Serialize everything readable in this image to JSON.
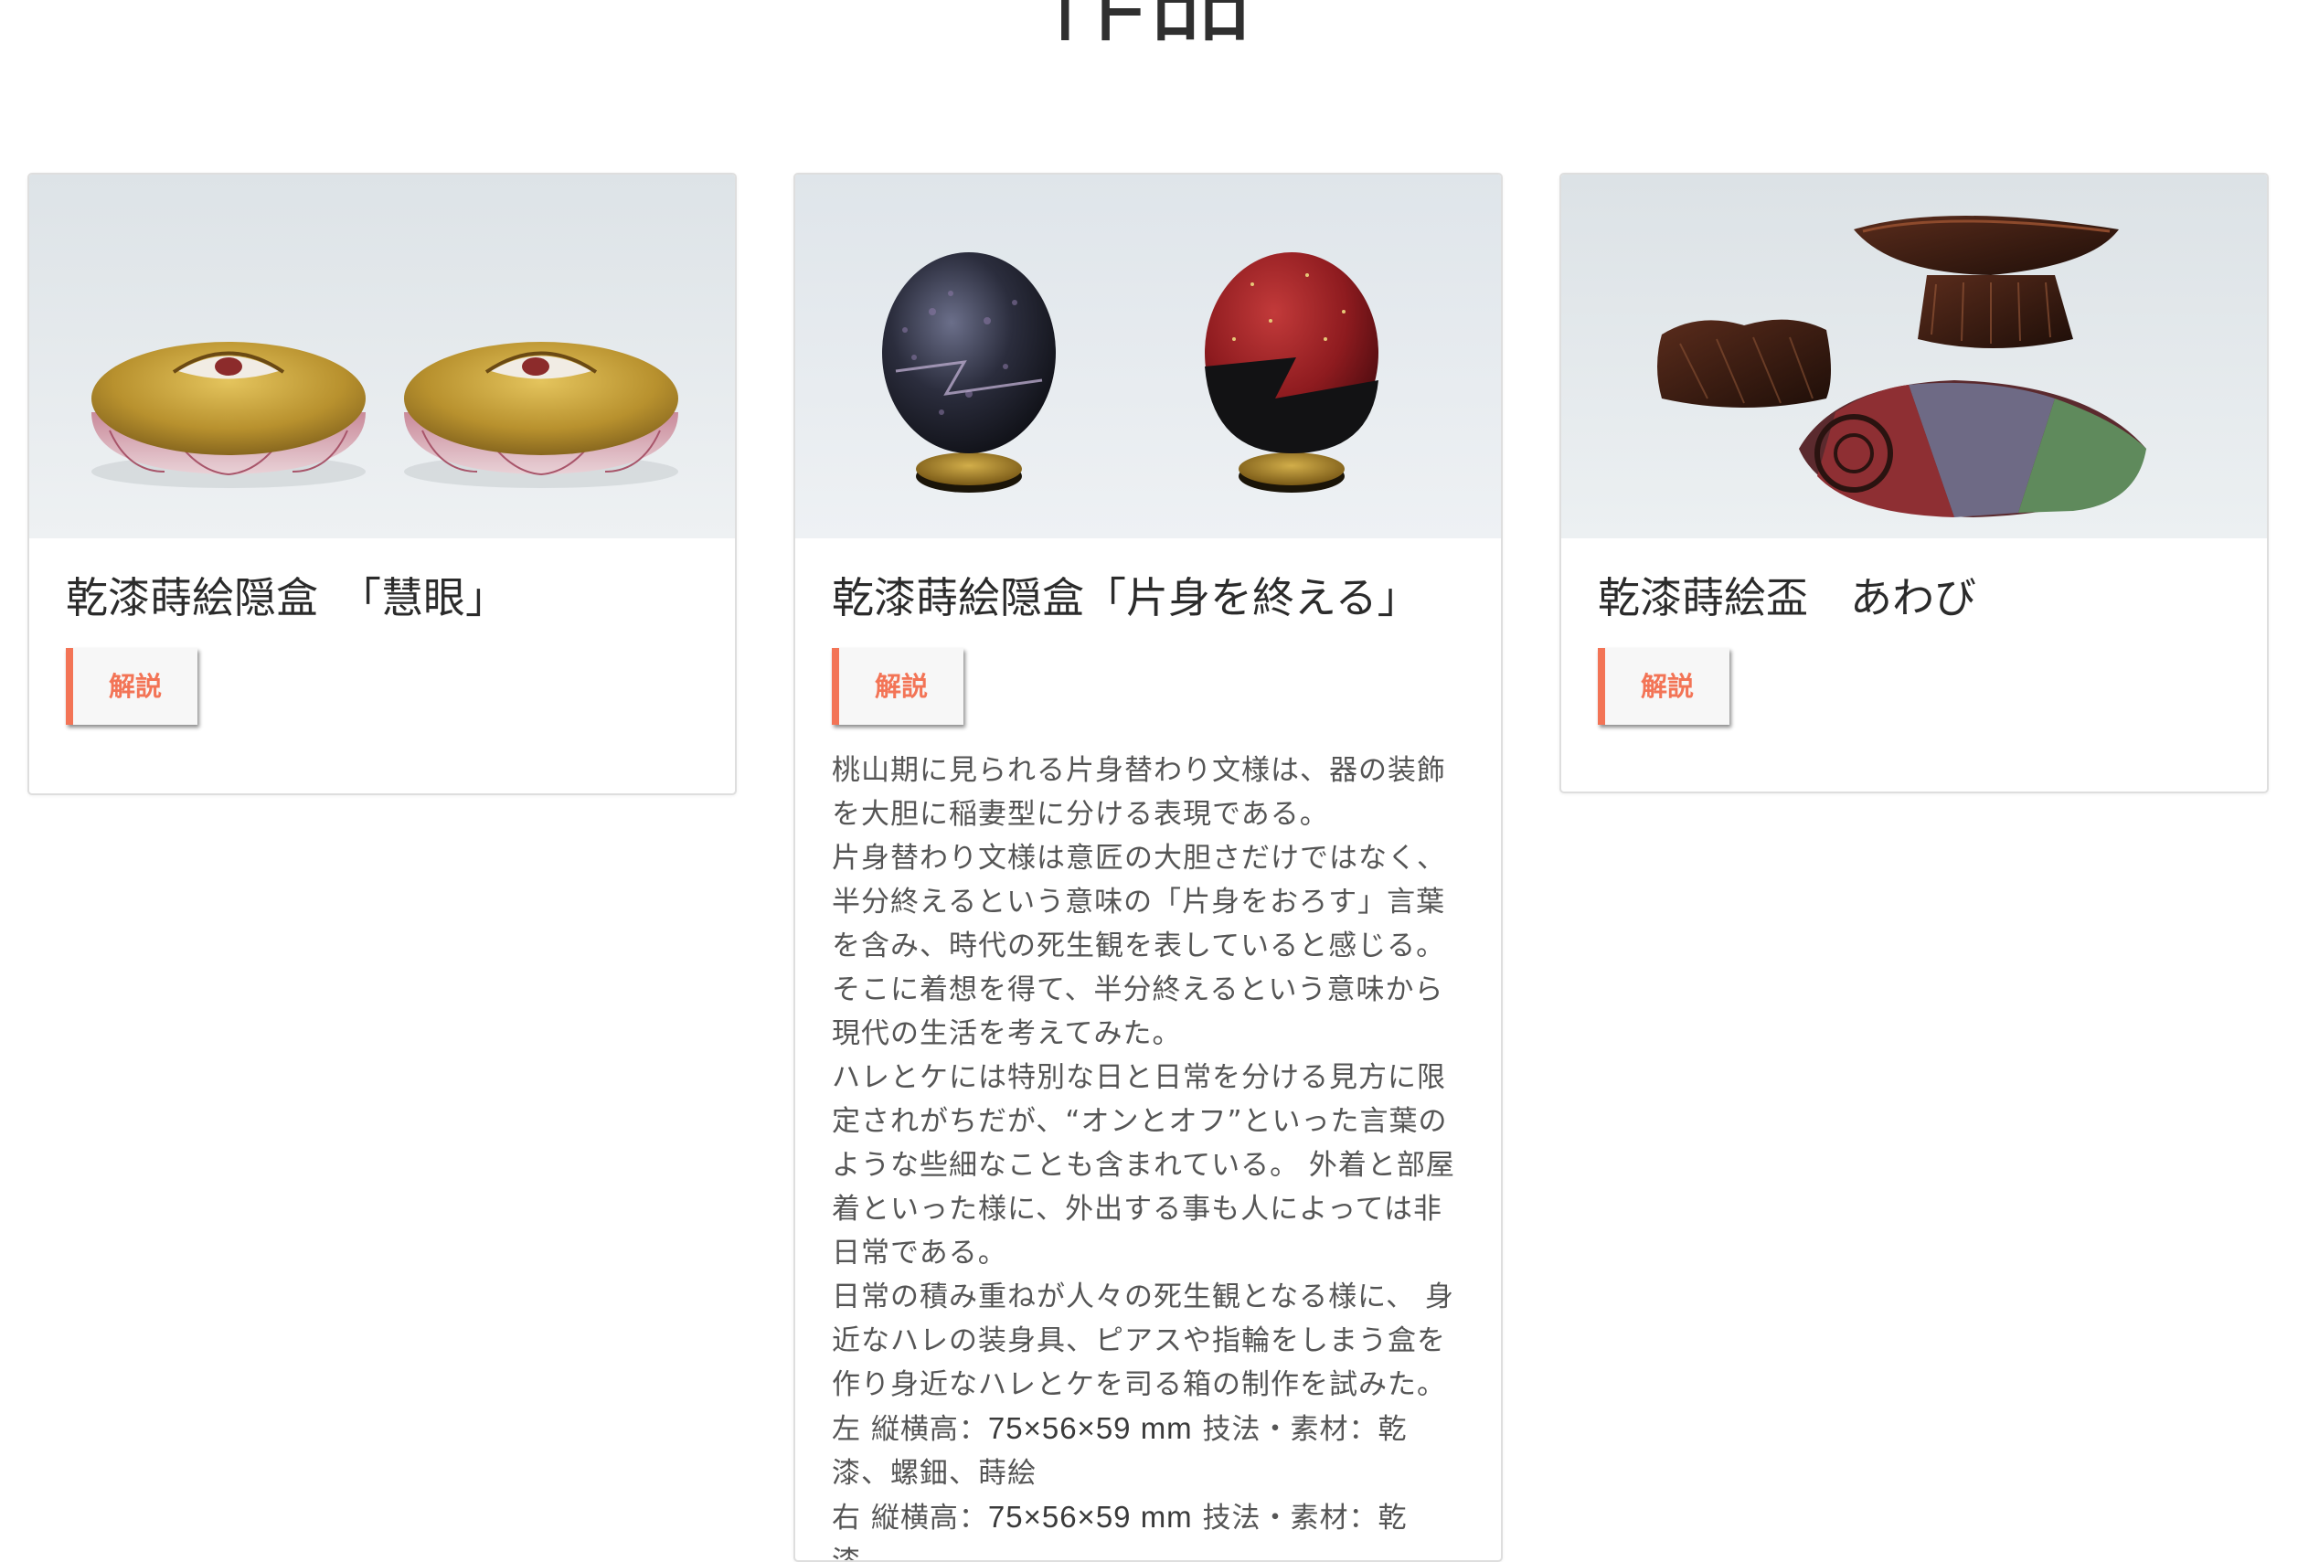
{
  "page": {
    "title": "作品"
  },
  "works": [
    {
      "title": "乾漆蒔絵隠盒　「慧眼」",
      "button_label": "解説"
    },
    {
      "title": "乾漆蒔絵隠盒「片身を終える」",
      "button_label": "解説",
      "description": [
        "桃山期に見られる片身替わり文様は、器の装飾を大胆に稲妻型に分ける表現である。",
        "片身替わり文様は意匠の大胆さだけではなく、半分終えるという意味の「片身をおろす」言葉を含み、時代の死生観を表していると感じる。そこに着想を得て、半分終えるという意味から現代の生活を考えてみた。",
        "ハレとケには特別な日と日常を分ける見方に限定されがちだが、“オンとオフ”といった言葉のような些細なことも含まれている。 外着と部屋着といった様に、外出する事も人によっては非日常である。",
        "日常の積み重ねが人々の死生観となる様に、 身近なハレの装身具、ピアスや指輪をしまう盒を作り身近なハレとケを司る箱の制作を試みた。"
      ],
      "specs": [
        {
          "prefix": "左 縦横高：",
          "dims": "75×56×59 mm",
          "suffix": " 技法・素材：乾漆、螺鈿、蒔絵"
        },
        {
          "prefix": "右 縦横高：",
          "dims": "75×56×59 mm",
          "suffix": " 技法・素材：乾漆、"
        }
      ]
    },
    {
      "title": "乾漆蒔絵盃　あわび",
      "button_label": "解説"
    }
  ],
  "colors": {
    "accent": "#f37456",
    "card_border": "#dedede",
    "image_background": "#e4e9ed"
  },
  "icons": {
    "card-1-image": "photo-golden-eye-boxes",
    "card-2-image": "photo-egg-shaped-boxes",
    "card-3-image": "photo-abalone-sake-cups"
  }
}
